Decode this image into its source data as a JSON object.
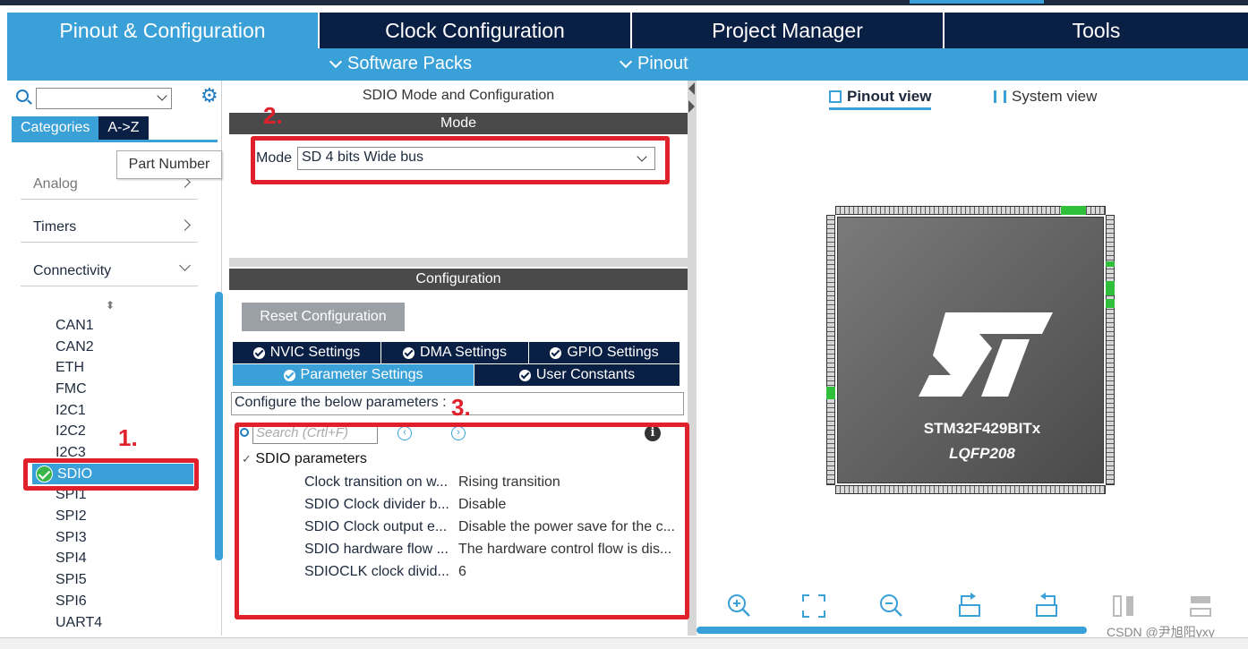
{
  "main_tabs": [
    {
      "label": "Pinout & Configuration"
    },
    {
      "label": "Clock Configuration"
    },
    {
      "label": "Project Manager"
    },
    {
      "label": "Tools"
    }
  ],
  "sub_bar": {
    "software_packs": "Software Packs",
    "pinout": "Pinout"
  },
  "left": {
    "search_value": "",
    "tabs": [
      "Categories",
      "A->Z"
    ],
    "tooltip": "Part Number",
    "categories": [
      "Analog",
      "Timers",
      "Connectivity"
    ],
    "peripherals": [
      "CAN1",
      "CAN2",
      "ETH",
      "FMC",
      "I2C1",
      "I2C2",
      "I2C3",
      "SDIO",
      "SPI1",
      "SPI2",
      "SPI3",
      "SPI4",
      "SPI5",
      "SPI6",
      "UART4"
    ],
    "selected": "SDIO"
  },
  "mode_panel": {
    "title": "SDIO Mode and Configuration",
    "mode_header": "Mode",
    "mode_label": "Mode",
    "mode_value": "SD 4 bits Wide bus"
  },
  "config_panel": {
    "header": "Configuration",
    "reset_button": "Reset Configuration",
    "tabs_row1": [
      "NVIC Settings",
      "DMA Settings",
      "GPIO Settings"
    ],
    "tabs_row2": [
      "Parameter Settings",
      "User Constants"
    ],
    "configure_text": "Configure the below parameters :",
    "search_placeholder": "Search (Crtl+F)",
    "group": "SDIO parameters",
    "params": [
      {
        "name": "Clock transition on w...",
        "value": "Rising transition"
      },
      {
        "name": "SDIO Clock divider b...",
        "value": "Disable"
      },
      {
        "name": "SDIO Clock output e...",
        "value": "Disable the power save for the c..."
      },
      {
        "name": "SDIO hardware flow ...",
        "value": "The hardware control flow is dis..."
      },
      {
        "name": "SDIOCLK clock divid...",
        "value": "6"
      }
    ]
  },
  "annotations": [
    "1.",
    "2.",
    "3."
  ],
  "right": {
    "view_tabs": [
      "Pinout view",
      "System view"
    ],
    "chip_name": "STM32F429BITx",
    "chip_package": "LQFP208"
  },
  "watermark": "CSDN @尹旭阳yxy",
  "colors": {
    "accent": "#3aa0d8",
    "navy": "#0a1f44",
    "annotation_red": "#e0202a",
    "ok_green": "#3ab54a"
  }
}
